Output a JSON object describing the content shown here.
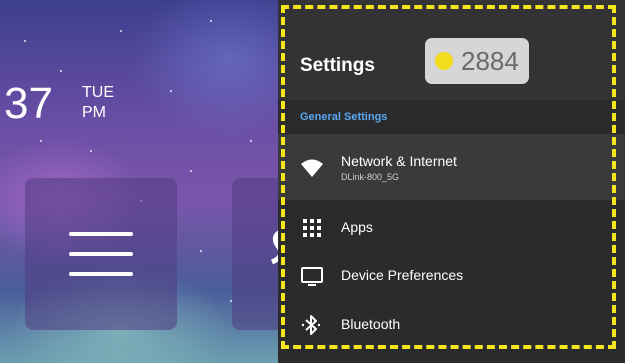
{
  "home": {
    "clock": {
      "time": "37",
      "day": "TUE",
      "ampm": "PM"
    }
  },
  "settings": {
    "title": "Settings",
    "coin_count": "2884",
    "section": "General Settings",
    "items": [
      {
        "icon": "wifi-icon",
        "label": "Network & Internet",
        "sublabel": "DLink-800_5G",
        "selected": true
      },
      {
        "icon": "grid-icon",
        "label": "Apps"
      },
      {
        "icon": "monitor-icon",
        "label": "Device Preferences"
      },
      {
        "icon": "bluetooth-icon",
        "label": "Bluetooth"
      }
    ]
  },
  "colors": {
    "panel": "#2b2b2d",
    "accent": "#5aa6f0",
    "highlight_dash": "#f5e51b",
    "coin": "#f2dc1e"
  }
}
